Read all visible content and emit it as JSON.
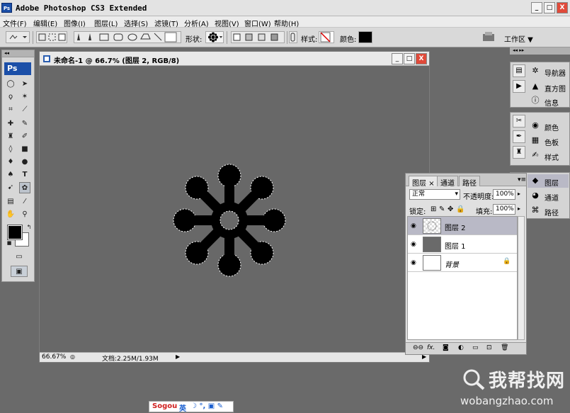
{
  "app": {
    "title": "Adobe Photoshop CS3 Extended",
    "logo": "Ps"
  },
  "window_controls": {
    "minimize": "_",
    "maximize": "□",
    "close": "X"
  },
  "menu": [
    "文件(F)",
    "编辑(E)",
    "图像(I)",
    "图层(L)",
    "选择(S)",
    "滤镜(T)",
    "分析(A)",
    "视图(V)",
    "窗口(W)",
    "帮助(H)"
  ],
  "options": {
    "shape_label": "形状:",
    "style_label": "样式:",
    "color_label": "颜色:",
    "workspace": "工作区 ▼"
  },
  "toolbox": {
    "logo": "Ps"
  },
  "document": {
    "title": "未命名-1 @ 66.7% (图层 2, RGB/8)",
    "zoom": "66.67%",
    "docsize": "文档:2.25M/1.93M"
  },
  "dock": {
    "group1": [
      "导航器",
      "直方图",
      "信息"
    ],
    "group2": [
      "颜色",
      "色板",
      "样式"
    ],
    "group3": [
      "图层",
      "通道",
      "路径"
    ]
  },
  "layers": {
    "tabs": [
      "图层",
      "通道",
      "路径"
    ],
    "blend_mode": "正常",
    "opacity_label": "不透明度:",
    "opacity": "100%",
    "lock_label": "锁定:",
    "fill_label": "填充:",
    "fill": "100%",
    "items": [
      {
        "name": "图层 2",
        "selected": true
      },
      {
        "name": "图层 1",
        "selected": false
      },
      {
        "name": "背景",
        "selected": false
      }
    ]
  },
  "watermark": {
    "text": "我帮找网",
    "url": "wobangzhao.com"
  },
  "ime": {
    "brand": "Sogou",
    "lang": "英"
  }
}
